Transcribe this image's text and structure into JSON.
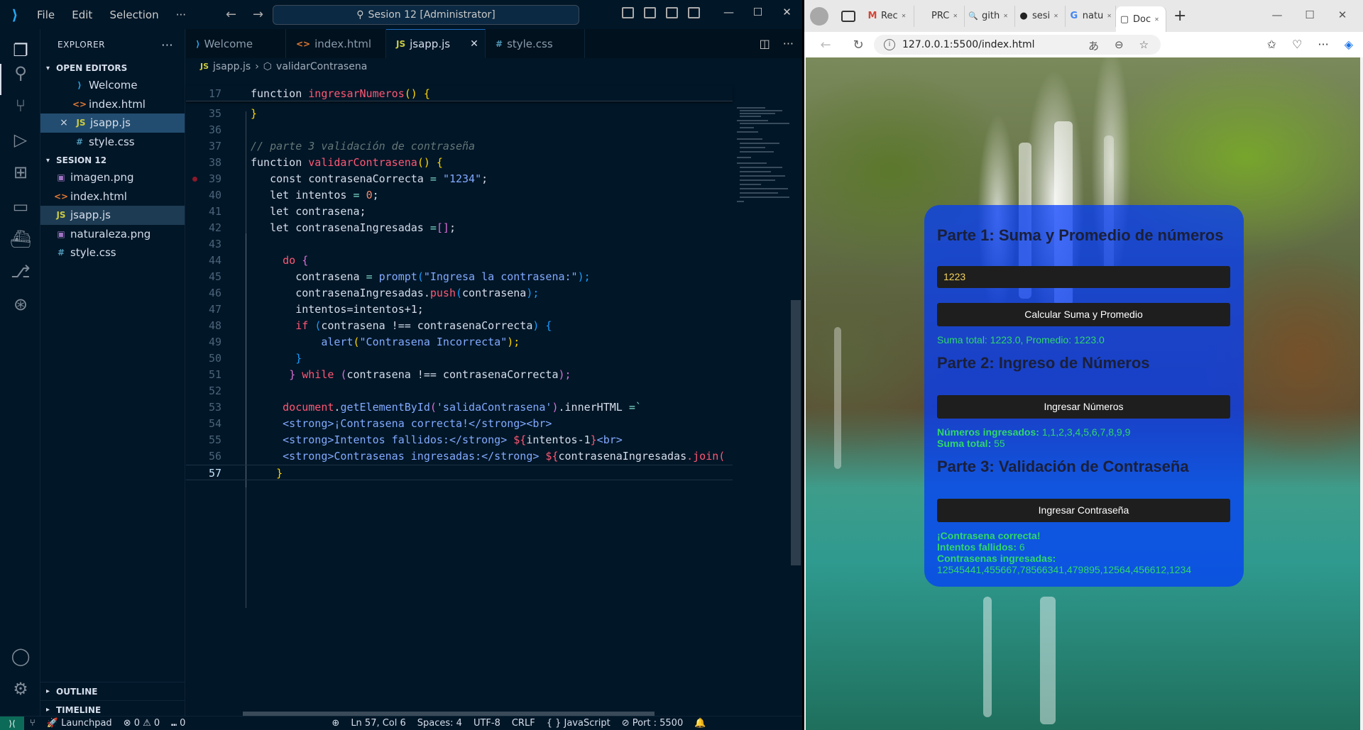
{
  "vscode": {
    "menu": [
      "File",
      "Edit",
      "Selection",
      "···"
    ],
    "command_center": "Sesion 12 [Administrator]",
    "explorer_title": "EXPLORER",
    "open_editors_label": "OPEN EDITORS",
    "open_editors": [
      {
        "name": "Welcome",
        "icon": "vscode-icon"
      },
      {
        "name": "index.html",
        "icon": "html-icon"
      },
      {
        "name": "jsapp.js",
        "icon": "js-icon",
        "modified_close": "×"
      },
      {
        "name": "style.css",
        "icon": "css-icon"
      }
    ],
    "folder_label": "SESION 12",
    "files": [
      {
        "name": "imagen.png",
        "icon": "image-icon"
      },
      {
        "name": "index.html",
        "icon": "html-icon"
      },
      {
        "name": "jsapp.js",
        "icon": "js-icon"
      },
      {
        "name": "naturaleza.png",
        "icon": "image-icon"
      },
      {
        "name": "style.css",
        "icon": "css-icon"
      }
    ],
    "outline_label": "OUTLINE",
    "timeline_label": "TIMELINE",
    "tabs": [
      {
        "label": "Welcome",
        "icon_glyph": "⟩"
      },
      {
        "label": "index.html",
        "icon_glyph": "<>"
      },
      {
        "label": "jsapp.js",
        "icon_glyph": "JS"
      },
      {
        "label": "style.css",
        "icon_glyph": "#"
      }
    ],
    "breadcrumb": {
      "file": "jsapp.js",
      "symbol": "validarContrasena"
    },
    "line_numbers": [
      "17",
      "35",
      "36",
      "37",
      "38",
      "39",
      "40",
      "41",
      "42",
      "43",
      "44",
      "45",
      "46",
      "47",
      "48",
      "49",
      "50",
      "51",
      "52",
      "53",
      "54",
      "55",
      "56",
      "57"
    ],
    "code": {
      "l17_kw": "function",
      "l17_fn": "ingresarNumeros",
      "l17_rest": "() {",
      "l35": "}",
      "l37": "// parte 3 validación de contraseña",
      "l38_kw": "function",
      "l38_fn": "validarContrasena",
      "l38_rest": "() {",
      "l39_kw": "const",
      "l39_var": "contrasenaCorrecta",
      "l39_op": "=",
      "l39_str": "\"1234\"",
      "l39_end": ";",
      "l40_kw": "let",
      "l40_var": "intentos",
      "l40_op": "=",
      "l40_num": "0",
      "l40_end": ";",
      "l41_kw": "let",
      "l41_var": "contrasena",
      "l41_end": ";",
      "l42_kw": "let",
      "l42_var": "contrasenaIngresadas",
      "l42_op": "=",
      "l42_br": "[]",
      "l42_end": ";",
      "l44_kw": "do",
      "l44_br": "{",
      "l45_var": "contrasena",
      "l45_op": "=",
      "l45_fn": "prompt",
      "l45_str": "\"Ingresa la contrasena:\"",
      "l45_end": ");",
      "l46_var": "contrasenaIngresadas",
      "l46_fn": "push",
      "l46_arg": "contrasena",
      "l46_end": ");",
      "l47": "intentos=intentos+1;",
      "l48_kw": "if",
      "l48_cond": "contrasena !== contrasenaCorrecta",
      "l48_br": "{",
      "l49_fn": "alert",
      "l49_str": "\"Contrasena Incorrecta\"",
      "l49_end": ");",
      "l50": "}",
      "l51_br": "}",
      "l51_kw": "while",
      "l51_cond": "contrasena !== contrasenaCorrecta",
      "l51_end": ");",
      "l53_obj": "document",
      "l53_fn": "getElementById",
      "l53_str": "'salidaContrasena'",
      "l53_prop": "innerHTML",
      "l53_op": "=`",
      "l54": "<strong>¡Contrasena correcta!</strong><br>",
      "l55_a": "<strong>Intentos fallidos:</strong> ",
      "l55_b": "${",
      "l55_c": "intentos-1",
      "l55_d": "}",
      "l55_e": "<br>",
      "l56_a": "<strong>Contrasenas ingresadas:</strong> ",
      "l56_b": "${",
      "l56_c": "contrasenaIngresadas",
      "l56_d": ".join(",
      "l57": "}"
    },
    "status": {
      "errors": "⊗ 0 ⚠ 0",
      "ports": "⑉ 0",
      "launchpad": "Launchpad",
      "position": "Ln 57, Col 6",
      "spaces": "Spaces: 4",
      "encoding": "UTF-8",
      "eol": "CRLF",
      "language": "{ } JavaScript",
      "port": "⊘ Port : 5500"
    }
  },
  "browser": {
    "tabs": [
      {
        "label": "Rec",
        "icon": "M"
      },
      {
        "label": "PRC",
        "icon": ""
      },
      {
        "label": "gith",
        "icon": "🔍"
      },
      {
        "label": "sesi",
        "icon": "●"
      },
      {
        "label": "natu",
        "icon": "G"
      },
      {
        "label": "Doc",
        "icon": "▢"
      }
    ],
    "url": "127.0.0.1:5500/index.html",
    "page": {
      "part1_title": "Parte 1: Suma y Promedio de números",
      "part1_input_value": "1223",
      "part1_button": "Calcular Suma y Promedio",
      "part1_result": "Suma total: 1223.0, Promedio: 1223.0",
      "part2_title": "Parte 2: Ingreso de Números",
      "part2_button": "Ingresar Números",
      "part2_numbers_label": "Números ingresados:",
      "part2_numbers_value": "1,1,2,3,4,5,6,7,8,9,9",
      "part2_sum_label": "Suma total:",
      "part2_sum_value": "55",
      "part3_title": "Parte 3: Validación de Contraseña",
      "part3_button": "Ingresar Contraseña",
      "part3_correct": "¡Contrasena correcta!",
      "part3_failed_label": "Intentos fallidos:",
      "part3_failed_value": "6",
      "part3_entered_label": "Contrasenas ingresadas:",
      "part3_entered_value": "12545441,455667,78566341,479895,12564,456612,1234"
    }
  }
}
